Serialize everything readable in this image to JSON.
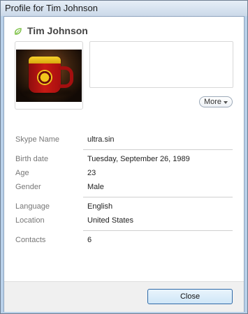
{
  "window": {
    "title": "Profile for Tim Johnson"
  },
  "profile": {
    "name": "Tim Johnson",
    "more_label": "More",
    "fields": [
      {
        "label": "Skype Name",
        "value": "ultra.sin"
      },
      {
        "label": "Birth date",
        "value": "Tuesday, September 26, 1989"
      },
      {
        "label": "Age",
        "value": "23"
      },
      {
        "label": "Gender",
        "value": "Male"
      },
      {
        "label": "Language",
        "value": "English"
      },
      {
        "label": "Location",
        "value": "United States"
      },
      {
        "label": "Contacts",
        "value": "6"
      }
    ]
  },
  "footer": {
    "close_label": "Close"
  },
  "icons": {
    "status": "online-leaf-icon",
    "more": "chevron-down-icon"
  },
  "colors": {
    "accent": "#83c44e",
    "window_border": "#6f7f92",
    "button_border": "#2f6aa8"
  }
}
